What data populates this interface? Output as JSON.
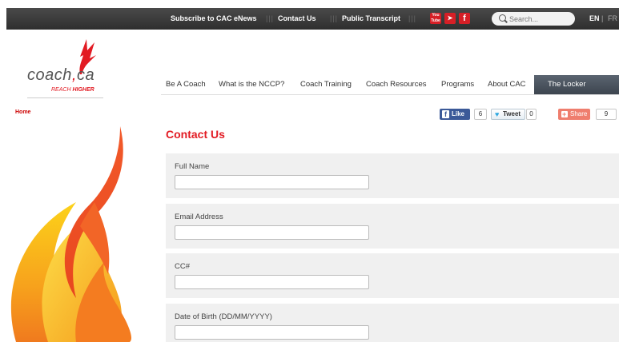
{
  "topbar": {
    "links": [
      "Subscribe to CAC eNews",
      "Contact Us",
      "Public Transcript"
    ],
    "social": [
      "You Tube",
      "twitter",
      "f"
    ],
    "search_placeholder": "Search...",
    "lang_en": "EN",
    "lang_sep": "|",
    "lang_fr": "FR"
  },
  "logo": {
    "word_left": "coach",
    "word_right": "ca",
    "tagline_left": "REACH ",
    "tagline_right": "HIGHER"
  },
  "nav": {
    "items": [
      "Be A Coach",
      "What is the NCCP?",
      "Coach Training",
      "Coach Resources",
      "Programs",
      "About CAC"
    ],
    "locker": "The Locker"
  },
  "breadcrumb": "Home",
  "share": {
    "like_label": "Like",
    "like_count": "6",
    "tweet_label": "Tweet",
    "tweet_count": "0",
    "share_label": "Share",
    "share_count": "9"
  },
  "page_title": "Contact Us",
  "form": {
    "fields": [
      {
        "label": "Full Name",
        "value": ""
      },
      {
        "label": "Email Address",
        "value": ""
      },
      {
        "label": "CC#",
        "value": ""
      },
      {
        "label": "Date of Birth (DD/MM/YYYY)",
        "value": ""
      }
    ]
  },
  "colors": {
    "accent_red": "#e21b23",
    "topbar": "#333333",
    "locker_bg": "#4a525c",
    "facebook": "#3b5998",
    "share": "#ef7e6e"
  }
}
